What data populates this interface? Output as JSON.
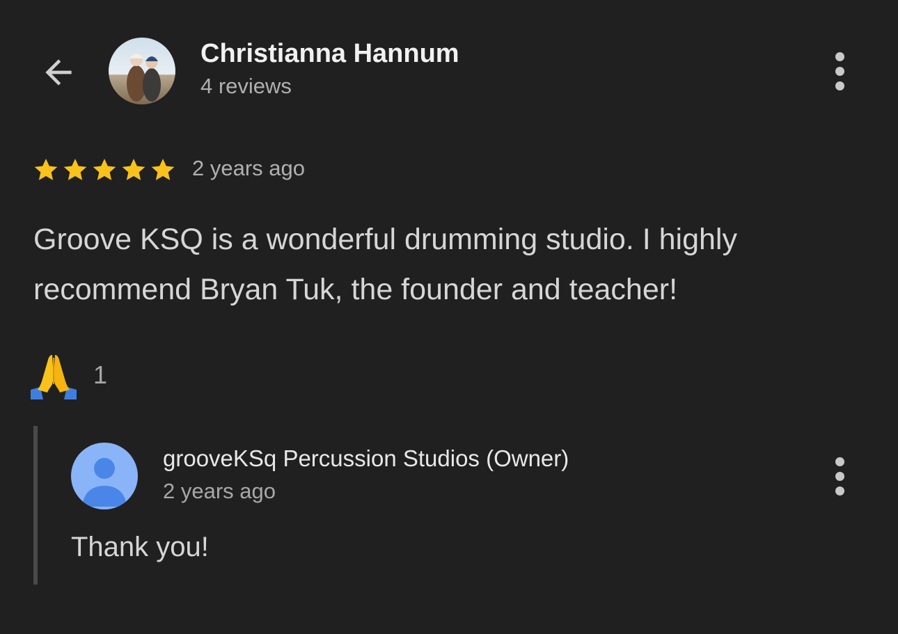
{
  "reviewer": {
    "name": "Christianna Hannum",
    "review_count": "4 reviews"
  },
  "review": {
    "rating": 5,
    "max_rating": 5,
    "date": "2 years ago",
    "text": "Groove KSQ is a wonderful drumming studio. I highly recommend Bryan Tuk, the founder and teacher!",
    "reaction_icon": "folded-hands-icon",
    "reaction_count": "1"
  },
  "owner_reply": {
    "name": "grooveKSq Percussion Studios (Owner)",
    "date": "2 years ago",
    "text": "Thank you!"
  },
  "icons": {
    "back": "arrow-left-icon",
    "menu": "more-vertical-icon",
    "star": "star-icon",
    "owner_avatar": "default-person-avatar-icon"
  },
  "colors": {
    "background": "#202020",
    "star": "#F8C21B",
    "avatar_placeholder_bg": "#8AB4F8",
    "avatar_placeholder_fg": "#4A86E8"
  }
}
